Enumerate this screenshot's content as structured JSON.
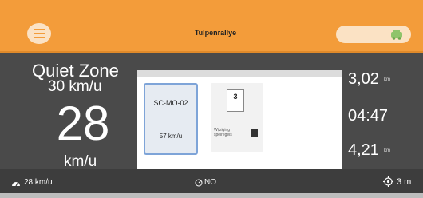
{
  "header": {
    "title": "Tulpenrallye",
    "menu_icon": "menu-icon",
    "status_icon": "car-icon",
    "accent_color": "#f39c3a"
  },
  "speed_zone": {
    "name": "Quiet Zone",
    "limit": "30 km/u",
    "current_speed": "28",
    "unit": "km/u"
  },
  "signs": {
    "first": {
      "code": "SC-MO-02",
      "speed": "57 km/u"
    },
    "second": {
      "number": "3",
      "caption": "Wijziging spelregels"
    }
  },
  "stats": {
    "distance": "3,02",
    "distance_unit": "km",
    "time": "04:47",
    "other": "4,21",
    "other_unit": "km"
  },
  "status": {
    "avg_speed": "28 km/u",
    "no_label": "NO",
    "gps": "3 m"
  }
}
